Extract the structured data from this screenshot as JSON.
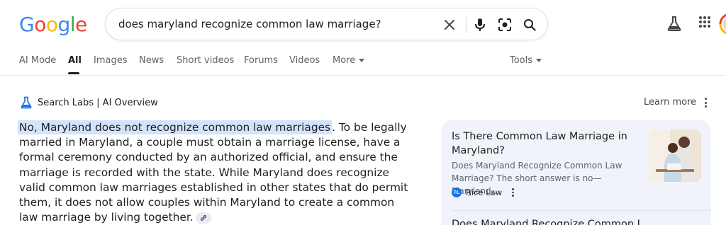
{
  "logo": {
    "letters": [
      "G",
      "o",
      "o",
      "g",
      "l",
      "e"
    ],
    "colors": [
      "#4285f4",
      "#ea4335",
      "#fbbc05",
      "#4285f4",
      "#34a853",
      "#ea4335"
    ]
  },
  "search": {
    "query": "does maryland recognize common law marriage?"
  },
  "header_icons": [
    "close-icon",
    "mic-icon",
    "lens-icon",
    "search-icon",
    "labs-icon",
    "apps-grid-icon",
    "account-avatar"
  ],
  "tabs": [
    {
      "label": "AI Mode",
      "active": false
    },
    {
      "label": "All",
      "active": true
    },
    {
      "label": "Images",
      "active": false
    },
    {
      "label": "News",
      "active": false
    },
    {
      "label": "Short videos",
      "active": false
    },
    {
      "label": "Forums",
      "active": false
    },
    {
      "label": "Videos",
      "active": false
    },
    {
      "label": "More",
      "active": false
    }
  ],
  "tools_label": "Tools",
  "ai_overview": {
    "title": "Search Labs | AI Overview",
    "learn_more": "Learn more",
    "highlight": "No, Maryland does not recognize common law marriages",
    "body": ". To be legally married in Maryland, a couple must obtain a marriage license, have a formal ceremony conducted by an authorized official, and ensure the marriage is recorded with the state. While Maryland does recognize valid common law marriages established in other states that do permit them, it does not allow couples within Maryland to create a common law marriage by living together."
  },
  "source_card": {
    "title": "Is There Common Law Marriage in Maryland?",
    "snippet": "Does Maryland Recognize Common Law Marriage? The short answer is no—Maryland…",
    "source": "Rice Law",
    "favicon_text": "RL",
    "next_title": "Does Maryland Recognize Common L…"
  },
  "colors": {
    "accent": "#1a73e8",
    "highlight": "#d3e3fd",
    "card_bg": "#f0f4fa"
  }
}
